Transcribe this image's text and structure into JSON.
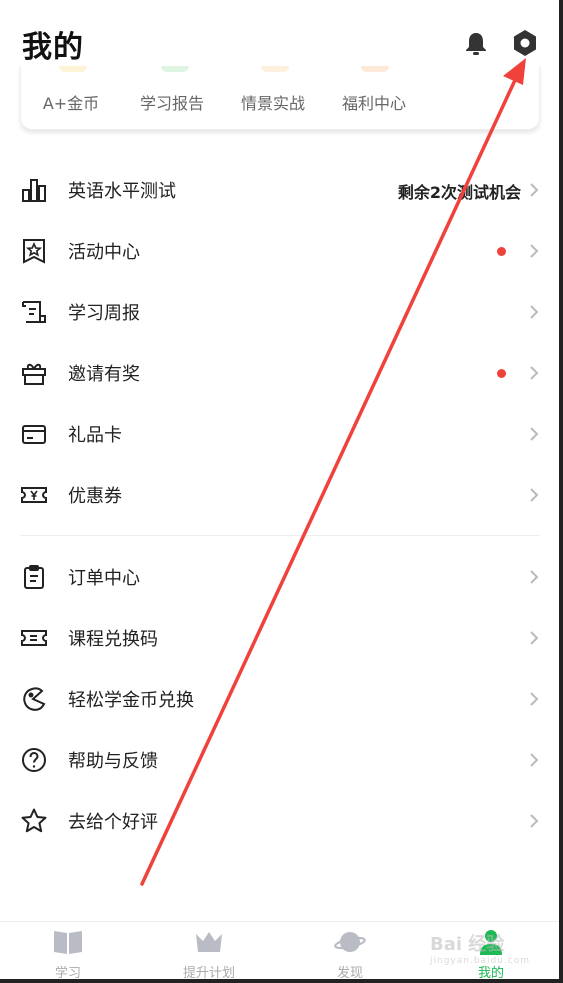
{
  "header": {
    "title": "我的",
    "bell_icon": "bell-icon",
    "settings_icon": "gear-icon"
  },
  "quick_links": [
    {
      "label": "A+金币",
      "dot_color": "#fdf3d6"
    },
    {
      "label": "学习报告",
      "dot_color": "#dff5e4"
    },
    {
      "label": "情景实战",
      "dot_color": "#fdf0dc"
    },
    {
      "label": "福利中心",
      "dot_color": "#fde9d8"
    }
  ],
  "menu": [
    {
      "label": "英语水平测试",
      "icon": "bar-chart-icon",
      "extra": "剩余2次测试机会",
      "dot": false
    },
    {
      "label": "活动中心",
      "icon": "star-badge-icon",
      "extra": "",
      "dot": true
    },
    {
      "label": "学习周报",
      "icon": "report-icon",
      "extra": "",
      "dot": false
    },
    {
      "label": "邀请有奖",
      "icon": "gift-icon",
      "extra": "",
      "dot": true
    },
    {
      "label": "礼品卡",
      "icon": "card-icon",
      "extra": "",
      "dot": false
    },
    {
      "label": "优惠券",
      "icon": "coupon-icon",
      "extra": "",
      "dot": false
    },
    {
      "label": "订单中心",
      "icon": "clipboard-icon",
      "extra": "",
      "dot": false
    },
    {
      "label": "课程兑换码",
      "icon": "ticket-icon",
      "extra": "",
      "dot": false
    },
    {
      "label": "轻松学金币兑换",
      "icon": "coin-exchange-icon",
      "extra": "",
      "dot": false
    },
    {
      "label": "帮助与反馈",
      "icon": "help-icon",
      "extra": "",
      "dot": false
    },
    {
      "label": "去给个好评",
      "icon": "star-icon",
      "extra": "",
      "dot": false
    }
  ],
  "tabbar": [
    {
      "label": "学习",
      "icon": "book-icon",
      "active": false
    },
    {
      "label": "提升计划",
      "icon": "crown-icon",
      "active": false
    },
    {
      "label": "发现",
      "icon": "planet-icon",
      "active": false
    },
    {
      "label": "我的",
      "icon": "user-icon",
      "active": true
    }
  ],
  "watermark": {
    "text": "Bai 经验",
    "sub": "jingyan.baidu.com"
  },
  "colors": {
    "accent_green": "#1db954",
    "red_dot": "#f0413b",
    "annotation_arrow": "#f0413b"
  }
}
